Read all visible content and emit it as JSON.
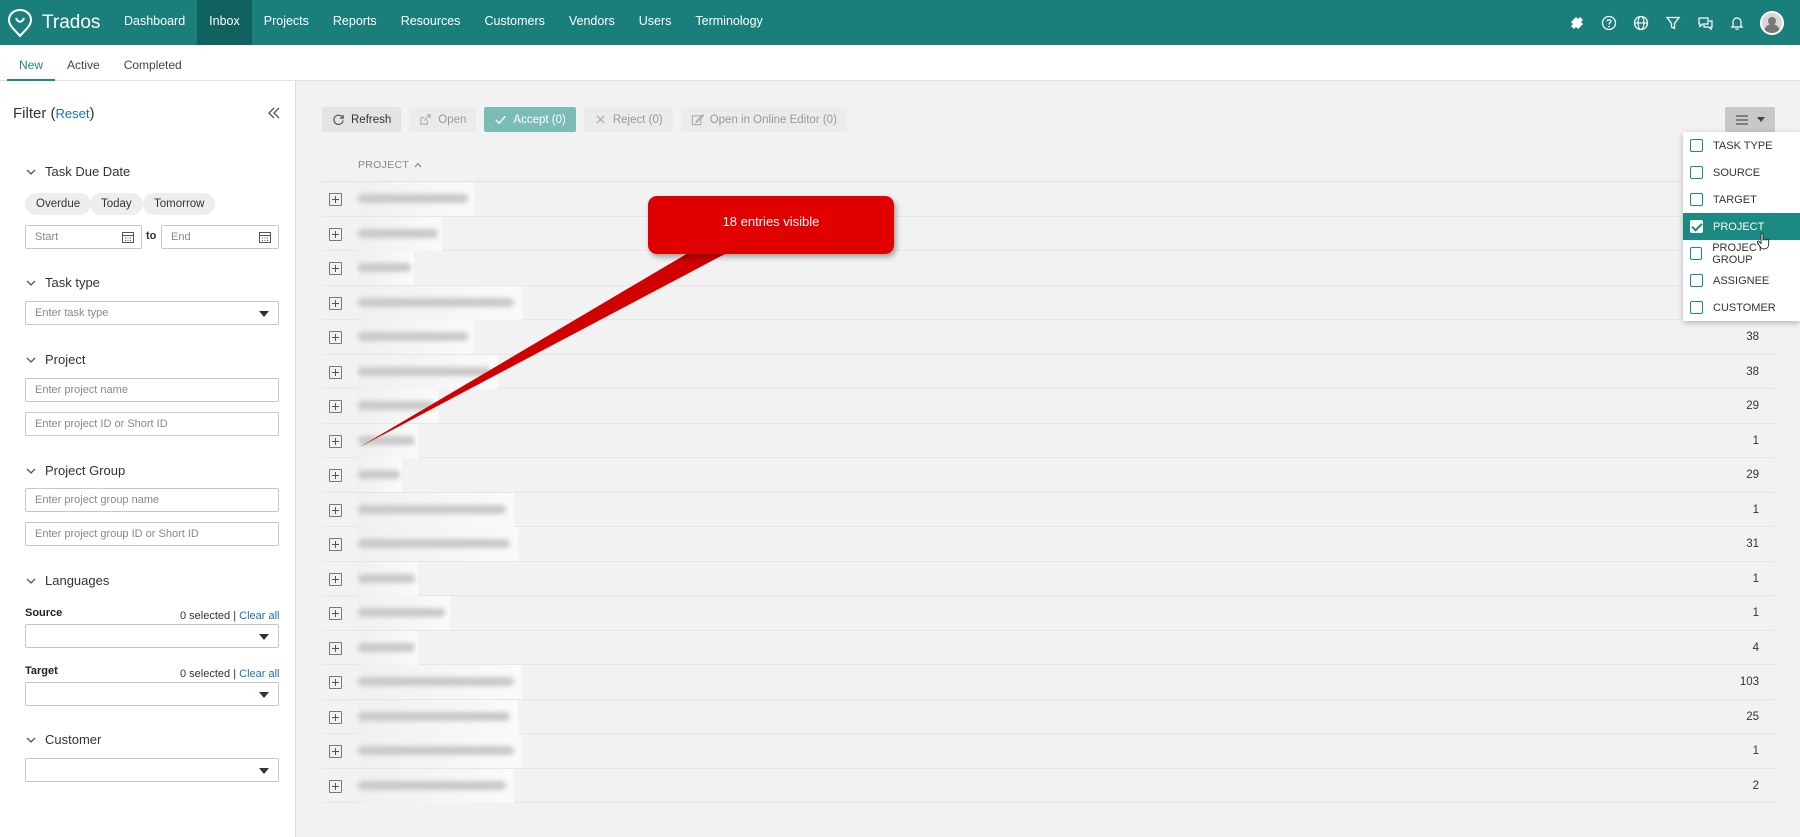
{
  "app": {
    "name": "Trados"
  },
  "nav": {
    "items": [
      {
        "label": "Dashboard",
        "active": false
      },
      {
        "label": "Inbox",
        "active": true
      },
      {
        "label": "Projects",
        "active": false
      },
      {
        "label": "Reports",
        "active": false
      },
      {
        "label": "Resources",
        "active": false
      },
      {
        "label": "Customers",
        "active": false
      },
      {
        "label": "Vendors",
        "active": false
      },
      {
        "label": "Users",
        "active": false
      },
      {
        "label": "Terminology",
        "active": false
      }
    ],
    "icons": [
      "puzzle-icon",
      "help-icon",
      "globe-icon",
      "filter-icon",
      "chat-icon",
      "bell-icon",
      "avatar"
    ]
  },
  "subtabs": [
    {
      "label": "New",
      "active": true
    },
    {
      "label": "Active",
      "active": false
    },
    {
      "label": "Completed",
      "active": false
    }
  ],
  "filter": {
    "title": "Filter",
    "reset": "Reset",
    "task_due_date": {
      "label": "Task Due Date",
      "chips": [
        "Overdue",
        "Today",
        "Tomorrow"
      ],
      "start_placeholder": "Start",
      "to": "to",
      "end_placeholder": "End"
    },
    "task_type": {
      "label": "Task type",
      "placeholder": "Enter task type"
    },
    "project": {
      "label": "Project",
      "name_placeholder": "Enter project name",
      "id_placeholder": "Enter project ID or Short ID"
    },
    "project_group": {
      "label": "Project Group",
      "name_placeholder": "Enter project group name",
      "id_placeholder": "Enter project group ID or Short ID"
    },
    "languages": {
      "label": "Languages",
      "source_label": "Source",
      "target_label": "Target",
      "selected_text": "0 selected",
      "separator": "|",
      "clear_all": "Clear all"
    },
    "customer": {
      "label": "Customer"
    }
  },
  "toolbar": {
    "refresh": "Refresh",
    "open": "Open",
    "accept": "Accept (0)",
    "reject": "Reject (0)",
    "open_online": "Open in Online Editor (0)"
  },
  "table": {
    "column_header": "PROJECT",
    "rows": [
      {
        "value": "",
        "blur_width": 0.58
      },
      {
        "value": "",
        "blur_width": 0.42
      },
      {
        "value": "",
        "blur_width": 0.28
      },
      {
        "value": "",
        "blur_width": 0.82
      },
      {
        "value": "38",
        "blur_width": 0.58
      },
      {
        "value": "38",
        "blur_width": 0.7
      },
      {
        "value": "29",
        "blur_width": 0.4
      },
      {
        "value": "1",
        "blur_width": 0.3
      },
      {
        "value": "29",
        "blur_width": 0.22
      },
      {
        "value": "1",
        "blur_width": 0.78
      },
      {
        "value": "31",
        "blur_width": 0.8
      },
      {
        "value": "1",
        "blur_width": 0.3
      },
      {
        "value": "1",
        "blur_width": 0.46
      },
      {
        "value": "4",
        "blur_width": 0.3
      },
      {
        "value": "103",
        "blur_width": 0.82
      },
      {
        "value": "25",
        "blur_width": 0.8
      },
      {
        "value": "1",
        "blur_width": 0.82
      },
      {
        "value": "2",
        "blur_width": 0.78
      }
    ]
  },
  "callout": {
    "text": "18 entries visible",
    "color": "#e10000"
  },
  "column_menu": {
    "options": [
      {
        "label": "TASK TYPE",
        "checked": false
      },
      {
        "label": "SOURCE",
        "checked": false
      },
      {
        "label": "TARGET",
        "checked": false
      },
      {
        "label": "PROJECT",
        "checked": true
      },
      {
        "label": "PROJECT GROUP",
        "checked": false
      },
      {
        "label": "ASSIGNEE",
        "checked": false
      },
      {
        "label": "CUSTOMER",
        "checked": false
      }
    ]
  },
  "colors": {
    "brand": "#1a7f7a",
    "brand_dark": "#0f625e",
    "accent": "#1a8a83",
    "link": "#1a73b5"
  }
}
